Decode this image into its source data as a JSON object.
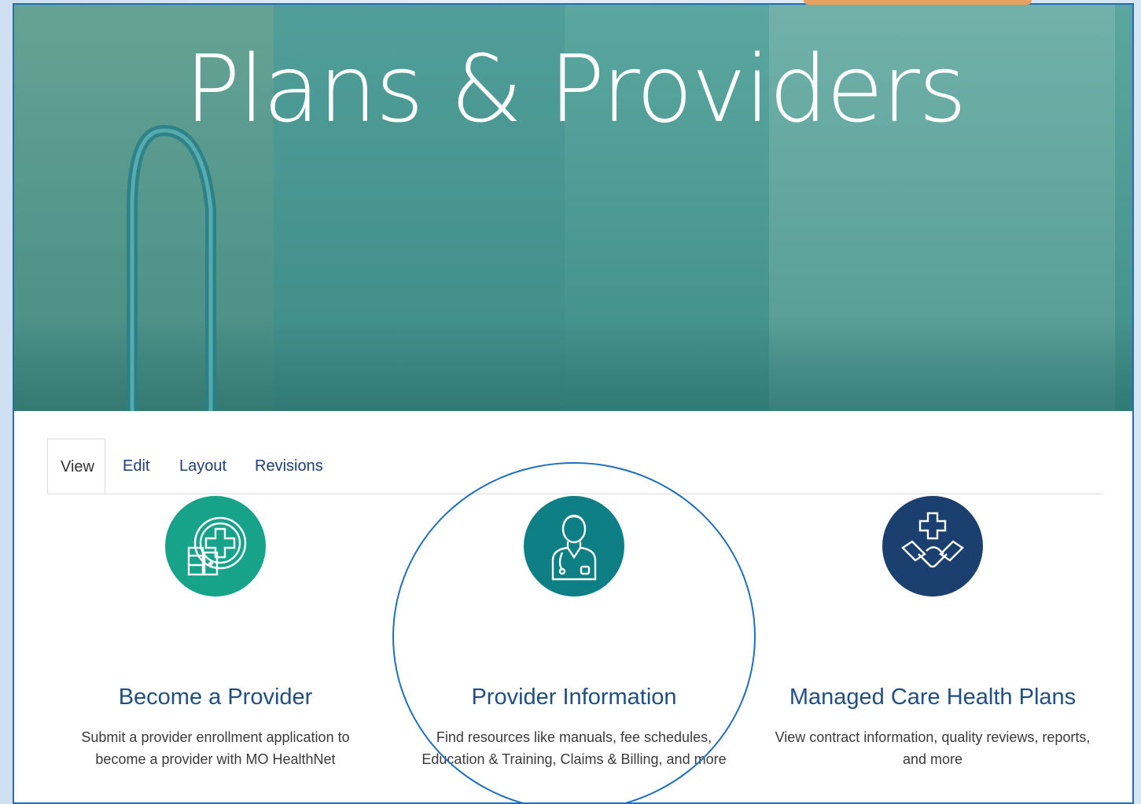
{
  "hero": {
    "title": "Plans & Providers"
  },
  "tabs": [
    {
      "label": "View",
      "active": true
    },
    {
      "label": "Edit",
      "active": false
    },
    {
      "label": "Layout",
      "active": false
    },
    {
      "label": "Revisions",
      "active": false
    }
  ],
  "cards": [
    {
      "title": "Become a Provider",
      "description": "Submit a provider enrollment application to become a provider with MO HealthNet",
      "icon": "medical-records-icon",
      "color": "#17a389"
    },
    {
      "title": "Provider Information",
      "description": "Find resources like manuals, fee schedules, Education & Training, Claims & Billing, and more",
      "icon": "doctor-icon",
      "color": "#0f7f86"
    },
    {
      "title": "Managed Care Health Plans",
      "description": "View contract information, quality reviews, reports, and more",
      "icon": "handshake-cross-icon",
      "color": "#1b3f6e"
    }
  ],
  "colors": {
    "frame": "#1f6fbf",
    "hero": "#4e9c95",
    "link": "#1f4f84"
  }
}
